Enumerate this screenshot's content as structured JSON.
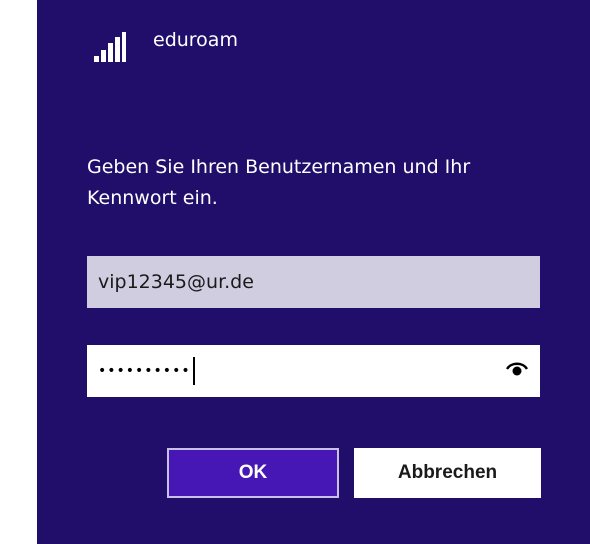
{
  "network": {
    "name": "eduroam",
    "icon": "wifi-signal-icon"
  },
  "instructions": "Geben Sie Ihren Benutzernamen und Ihr Kennwort ein.",
  "username": {
    "value": "vip12345@ur.de"
  },
  "password": {
    "masked_value": "••••••••••",
    "reveal_icon": "eye-icon"
  },
  "buttons": {
    "ok_label": "OK",
    "cancel_label": "Abbrechen"
  },
  "colors": {
    "background": "#200e6a",
    "ok_button": "#4617b4",
    "username_field": "#d0cde0"
  }
}
